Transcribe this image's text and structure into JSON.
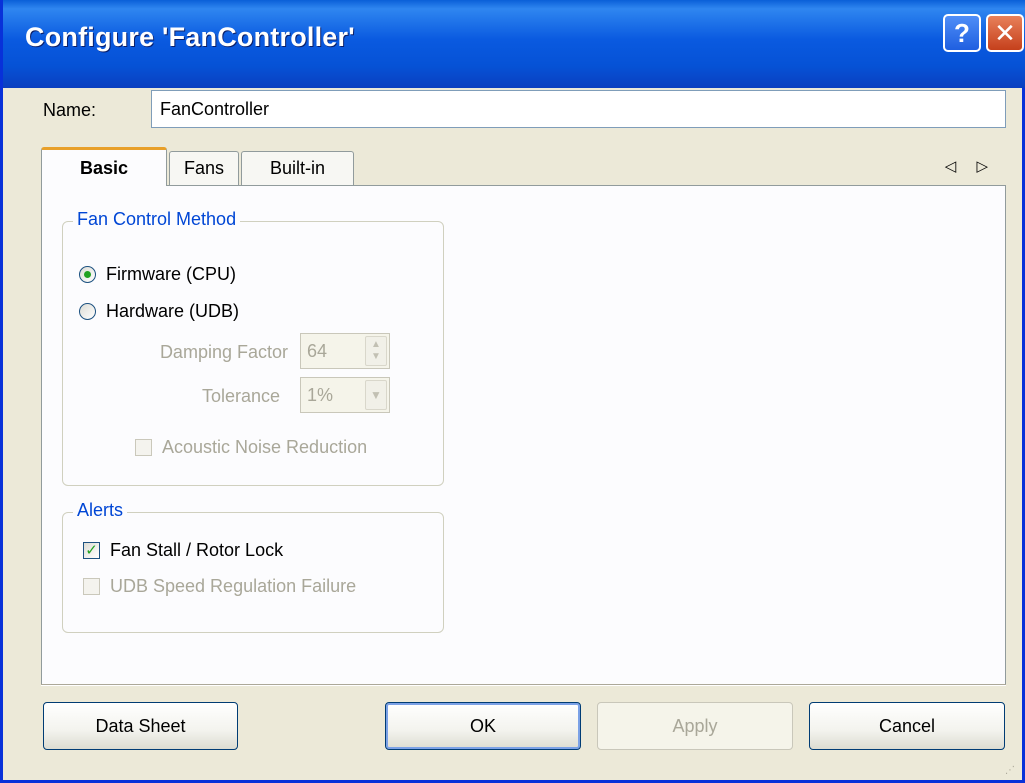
{
  "window": {
    "title": "Configure 'FanController'",
    "help_glyph": "?",
    "close_glyph": "✕",
    "colors": {
      "titlebar": "#0a5ae0",
      "face": "#ece9d8",
      "group_title": "#0046d5",
      "tab_highlight": "#e8a02a"
    }
  },
  "name_field": {
    "label": "Name:",
    "value": "FanController"
  },
  "tabs": [
    {
      "label": "Basic",
      "selected": true
    },
    {
      "label": "Fans",
      "selected": false
    },
    {
      "label": "Built-in",
      "selected": false
    }
  ],
  "tab_scroll_arrows": "◁ ▷",
  "fan_control_method": {
    "title": "Fan Control Method",
    "options": [
      {
        "label": "Firmware (CPU)",
        "selected": true
      },
      {
        "label": "Hardware (UDB)",
        "selected": false
      }
    ],
    "damping_factor": {
      "label": "Damping Factor",
      "value": "64",
      "enabled": false
    },
    "tolerance": {
      "label": "Tolerance",
      "value": "1%",
      "enabled": false
    },
    "acoustic_noise_reduction": {
      "label": "Acoustic Noise Reduction",
      "checked": false,
      "enabled": false
    }
  },
  "alerts": {
    "title": "Alerts",
    "items": [
      {
        "label": "Fan Stall / Rotor Lock",
        "checked": true,
        "enabled": true
      },
      {
        "label": "UDB Speed Regulation Failure",
        "checked": false,
        "enabled": false
      }
    ]
  },
  "buttons": {
    "data_sheet": "Data Sheet",
    "ok": "OK",
    "apply": "Apply",
    "cancel": "Cancel"
  }
}
